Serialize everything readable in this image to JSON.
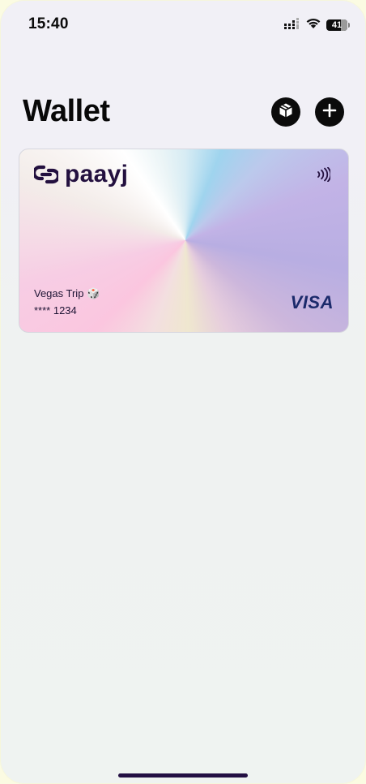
{
  "status_bar": {
    "time": "15:40",
    "battery_level": "41",
    "signal_icon": "cellular-signal-icon",
    "wifi_icon": "wifi-icon"
  },
  "header": {
    "title": "Wallet",
    "cards_button_icon": "cube-icon",
    "add_button_icon": "plus-icon"
  },
  "card": {
    "brand": "paayj",
    "name": "Vegas Trip 🎲",
    "number": "**** 1234",
    "network": "VISA",
    "contactless_icon": "contactless-icon",
    "brand_color": "#23103f",
    "network_color": "#1b2a6b"
  },
  "colors": {
    "background": "#eff2f1",
    "accent": "#0b0b0b"
  }
}
